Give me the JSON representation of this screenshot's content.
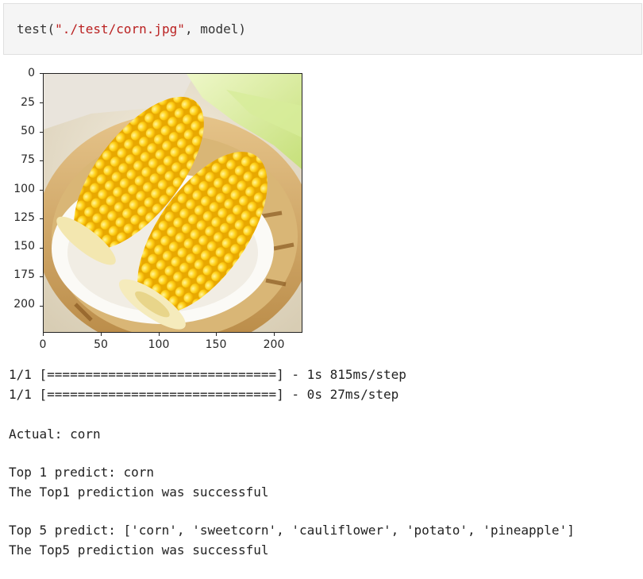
{
  "code_cell": {
    "fn_name": "test",
    "open_paren": "(",
    "path_string": "\"./test/corn.jpg\"",
    "separator": ", ",
    "arg_model": "model",
    "close_paren": ")"
  },
  "figure": {
    "image_subject": "corn-image",
    "y_ticks": [
      "0",
      "25",
      "50",
      "75",
      "100",
      "125",
      "150",
      "175",
      "200"
    ],
    "x_ticks": [
      "0",
      "50",
      "100",
      "150",
      "200"
    ]
  },
  "output": {
    "progress_line_1": "1/1 [==============================] - 1s 815ms/step",
    "progress_line_2": "1/1 [==============================] - 0s 27ms/step",
    "actual": "Actual: corn",
    "top1_predict": "Top 1 predict: corn",
    "top1_result": "The Top1 prediction was successful",
    "top5_predict": "Top 5 predict: ['corn', 'sweetcorn', 'cauliflower', 'potato', 'pineapple']",
    "top5_result": "The Top5 prediction was successful"
  }
}
